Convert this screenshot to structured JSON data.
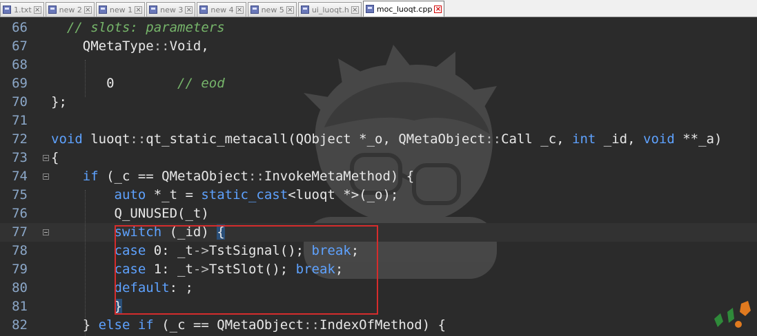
{
  "tabs": [
    {
      "label": "1.txt",
      "active": false
    },
    {
      "label": "new 2",
      "active": false
    },
    {
      "label": "new 1",
      "active": false
    },
    {
      "label": "new 3",
      "active": false
    },
    {
      "label": "new 4",
      "active": false
    },
    {
      "label": "new 5",
      "active": false
    },
    {
      "label": "ui_luoqt.h",
      "active": false
    },
    {
      "label": "moc_luoqt.cpp",
      "active": true
    }
  ],
  "lines": [
    {
      "n": "66",
      "tokens": [
        {
          "t": "  ",
          "c": ""
        },
        {
          "t": "// slots: parameters",
          "c": "c"
        }
      ]
    },
    {
      "n": "67",
      "tokens": [
        {
          "t": "    QMetaType",
          "c": ""
        },
        {
          "t": "::",
          "c": "op"
        },
        {
          "t": "Void,",
          "c": ""
        }
      ]
    },
    {
      "n": "68",
      "tokens": []
    },
    {
      "n": "69",
      "tokens": [
        {
          "t": "       0        ",
          "c": ""
        },
        {
          "t": "// eod",
          "c": "c"
        }
      ]
    },
    {
      "n": "70",
      "tokens": [
        {
          "t": "};",
          "c": ""
        }
      ]
    },
    {
      "n": "71",
      "tokens": []
    },
    {
      "n": "72",
      "tokens": [
        {
          "t": "void",
          "c": "k"
        },
        {
          "t": " luoqt",
          "c": ""
        },
        {
          "t": "::",
          "c": "op"
        },
        {
          "t": "qt_static_metacall(QObject *_o, QMetaObject",
          "c": ""
        },
        {
          "t": "::",
          "c": "op"
        },
        {
          "t": "Call _c, ",
          "c": ""
        },
        {
          "t": "int",
          "c": "k"
        },
        {
          "t": " _id, ",
          "c": ""
        },
        {
          "t": "void",
          "c": "k"
        },
        {
          "t": " **_a)",
          "c": ""
        }
      ]
    },
    {
      "n": "73",
      "tokens": [
        {
          "t": "{",
          "c": ""
        }
      ]
    },
    {
      "n": "74",
      "tokens": [
        {
          "t": "    ",
          "c": ""
        },
        {
          "t": "if",
          "c": "k"
        },
        {
          "t": " (_c == QMetaObject",
          "c": ""
        },
        {
          "t": "::",
          "c": "op"
        },
        {
          "t": "InvokeMetaMethod) {",
          "c": ""
        }
      ]
    },
    {
      "n": "75",
      "tokens": [
        {
          "t": "        ",
          "c": ""
        },
        {
          "t": "auto",
          "c": "k"
        },
        {
          "t": " *_t = ",
          "c": ""
        },
        {
          "t": "static_cast",
          "c": "k"
        },
        {
          "t": "<luoqt *>(_o);",
          "c": ""
        }
      ]
    },
    {
      "n": "76",
      "tokens": [
        {
          "t": "        Q_UNUSED(_t)",
          "c": ""
        }
      ]
    },
    {
      "n": "77",
      "tokens": [
        {
          "t": "        ",
          "c": ""
        },
        {
          "t": "switch",
          "c": "k"
        },
        {
          "t": " (_id) ",
          "c": ""
        },
        {
          "t": "{",
          "c": "hl"
        }
      ]
    },
    {
      "n": "78",
      "tokens": [
        {
          "t": "        ",
          "c": ""
        },
        {
          "t": "case",
          "c": "k"
        },
        {
          "t": " 0: _t",
          "c": ""
        },
        {
          "t": "->",
          "c": "op"
        },
        {
          "t": "TstSignal(); ",
          "c": ""
        },
        {
          "t": "break",
          "c": "k"
        },
        {
          "t": ";",
          "c": ""
        }
      ]
    },
    {
      "n": "79",
      "tokens": [
        {
          "t": "        ",
          "c": ""
        },
        {
          "t": "case",
          "c": "k"
        },
        {
          "t": " 1: _t",
          "c": ""
        },
        {
          "t": "->",
          "c": "op"
        },
        {
          "t": "TstSlot(); ",
          "c": ""
        },
        {
          "t": "break",
          "c": "k"
        },
        {
          "t": ";",
          "c": ""
        }
      ]
    },
    {
      "n": "80",
      "tokens": [
        {
          "t": "        ",
          "c": ""
        },
        {
          "t": "default",
          "c": "k"
        },
        {
          "t": ": ;",
          "c": ""
        }
      ]
    },
    {
      "n": "81",
      "tokens": [
        {
          "t": "        ",
          "c": ""
        },
        {
          "t": "}",
          "c": "hl"
        }
      ]
    },
    {
      "n": "82",
      "tokens": [
        {
          "t": "    } ",
          "c": ""
        },
        {
          "t": "else",
          "c": "k"
        },
        {
          "t": " ",
          "c": ""
        },
        {
          "t": "if",
          "c": "k"
        },
        {
          "t": " (_c == QMetaObject",
          "c": ""
        },
        {
          "t": "::",
          "c": "op"
        },
        {
          "t": "IndexOfMethod) {",
          "c": ""
        }
      ]
    }
  ],
  "colors": {
    "keyword": "#5ea2ff",
    "comment": "#76b56a",
    "line_number": "#8ba7c8",
    "background": "#2b2b2b",
    "highlight_box": "#d62c2c"
  }
}
